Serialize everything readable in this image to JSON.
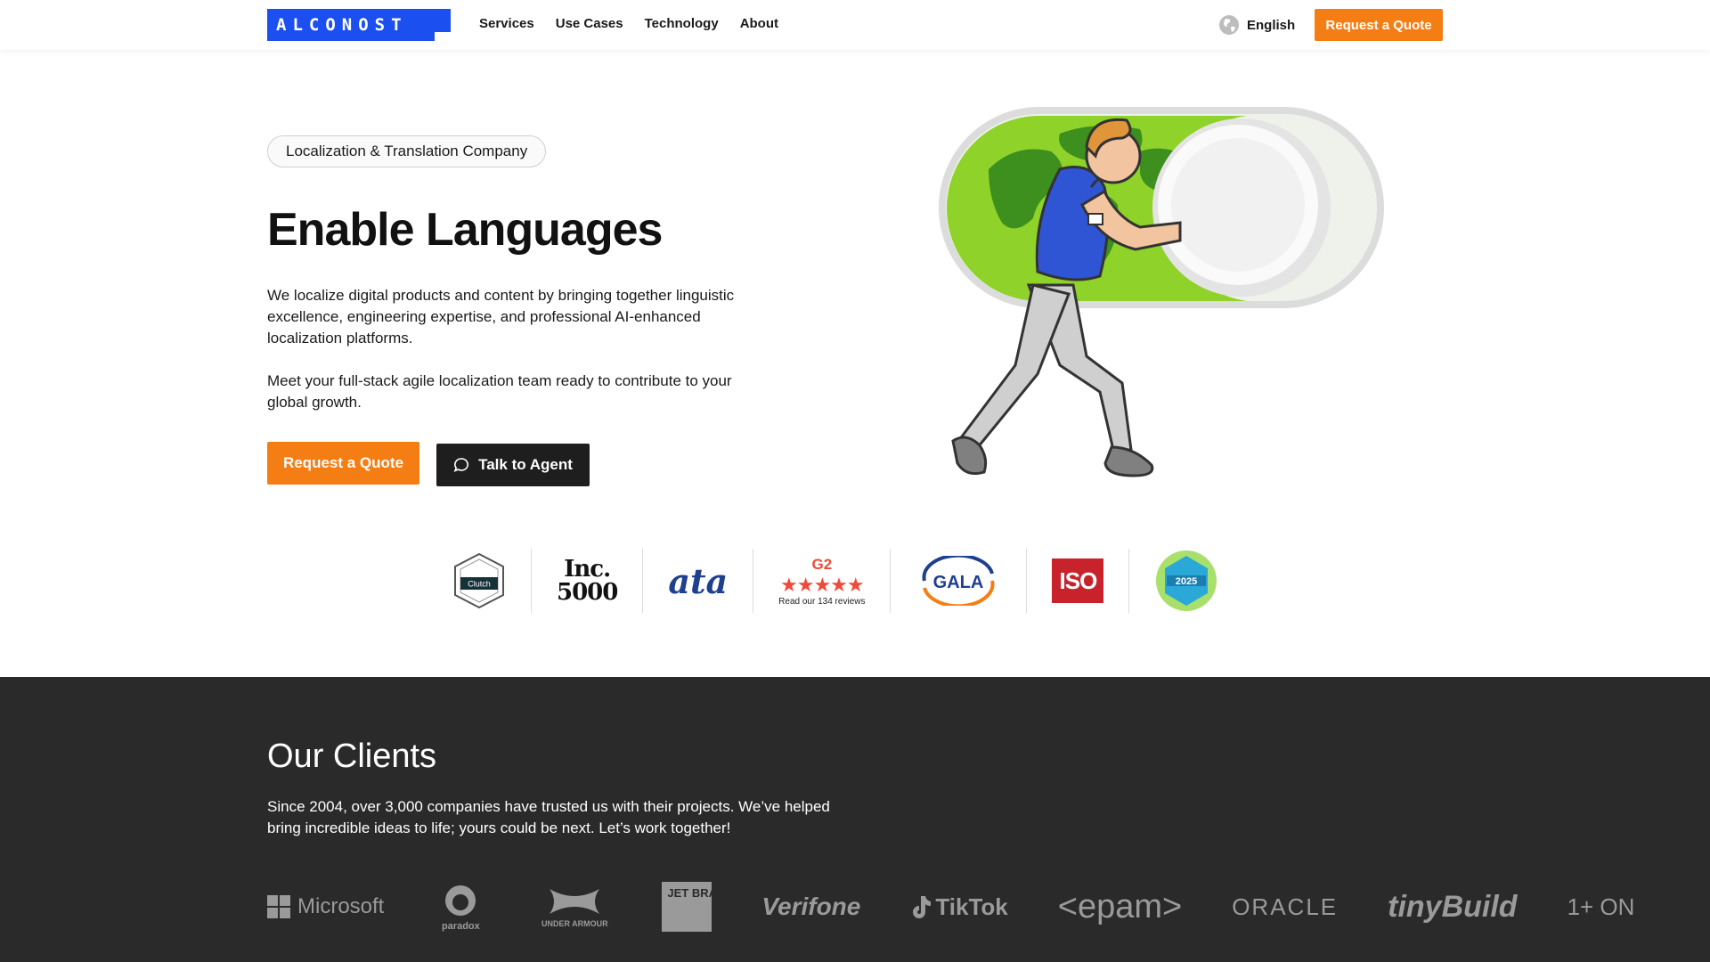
{
  "header": {
    "logo_text": "ALCONOST",
    "nav": [
      "Services",
      "Use Cases",
      "Technology",
      "About"
    ],
    "language": "English",
    "cta": "Request a Quote"
  },
  "hero": {
    "badge": "Localization & Translation Company",
    "title": "Enable Languages",
    "paragraph1": "We localize digital products and content by bringing together linguistic excellence, engineering expertise, and professional AI-enhanced localization platforms.",
    "paragraph2": "Meet your full-stack agile localization team ready to contribute to your global growth.",
    "primary_button": "Request a Quote",
    "secondary_button": "Talk to Agent"
  },
  "awards": {
    "clutch": "Clutch",
    "inc_top": "Inc.",
    "inc_bottom": "5000",
    "ata": "ata",
    "g2_logo": "G2",
    "g2_stars": "★★★★★",
    "g2_reviews": "Read our 134 reviews",
    "gala": "GALA",
    "iso": "ISO",
    "slator_year": "2025"
  },
  "clients": {
    "title": "Our Clients",
    "text": "Since 2004, over 3,000 companies have trusted us with their projects. We’ve helped bring incredible ideas to life; yours could be next. Let’s work together!",
    "logos": {
      "microsoft": "Microsoft",
      "paradox": "paradox",
      "underarmour": "UNDER ARMOUR",
      "jetbrains": "JET BRAINS",
      "verifone": "Verifone",
      "tiktok": "TikTok",
      "epam": "<epam>",
      "oracle": "ORACLE",
      "tinybuild": "tinyBuild",
      "oneplus": "1+ ON"
    }
  },
  "colors": {
    "brand_blue": "#1c4ff0",
    "accent_orange": "#f57e14",
    "dark": "#2a2a2a"
  }
}
